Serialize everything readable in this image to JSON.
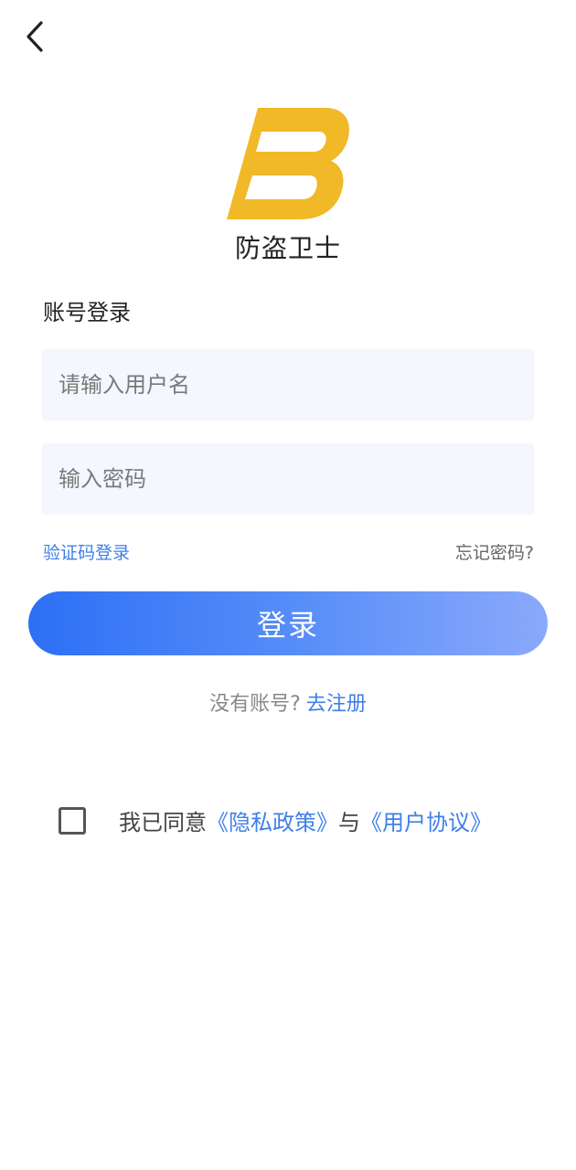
{
  "header": {
    "back_icon": "chevron-left-icon"
  },
  "brand": {
    "logo_icon": "fb-logo-icon",
    "logo_color": "#f1b928",
    "app_name": "防盗卫士"
  },
  "login": {
    "title": "账号登录",
    "username_placeholder": "请输入用户名",
    "username_value": "",
    "password_placeholder": "输入密码",
    "password_value": "",
    "sms_login_label": "验证码登录",
    "forgot_password_label": "忘记密码?",
    "submit_label": "登录",
    "accent_color": "#2d6ff5"
  },
  "register": {
    "prompt": "没有账号?",
    "link_label": "去注册"
  },
  "agreement": {
    "checked": false,
    "prefix": "我已同意",
    "privacy_label": "《隐私政策》",
    "joiner": "与",
    "terms_label": "《用户协议》"
  }
}
